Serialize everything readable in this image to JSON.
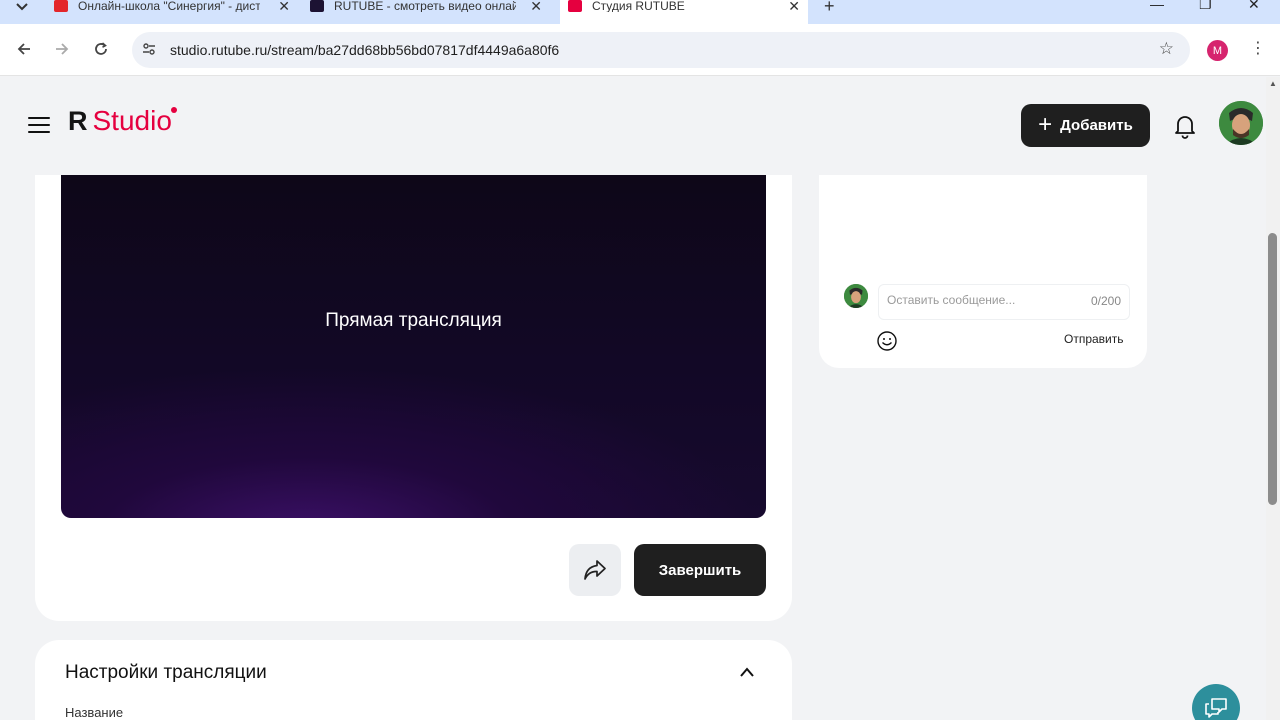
{
  "browser": {
    "tabs": [
      {
        "title": "Онлайн-школа \"Синергия\" - дист",
        "favicon_color": "#e3262b",
        "active": false
      },
      {
        "title": "RUTUBE - смотреть видео онлай",
        "favicon_color": "#1c1233",
        "active": false
      },
      {
        "title": "Студия RUTUBE",
        "favicon_color": "#e5003f",
        "active": true
      }
    ],
    "url": "studio.rutube.ru/stream/ba27dd68bb56bd07817df4449a6a80f6",
    "profile_initial": "M",
    "profile_color": "#d6246e"
  },
  "header": {
    "logo_letter": "R",
    "logo_text": "Studio",
    "add_label": "Добавить"
  },
  "player": {
    "overlay_text": "Прямая трансляция",
    "finish_label": "Завершить"
  },
  "settings": {
    "title": "Настройки трансляции",
    "name_label": "Название"
  },
  "chat": {
    "placeholder": "Оставить сообщение...",
    "counter": "0/200",
    "send_label": "Отправить"
  },
  "colors": {
    "brand": "#e5003f",
    "dark_button": "#1f1f1f",
    "support": "#2d8f9c"
  }
}
